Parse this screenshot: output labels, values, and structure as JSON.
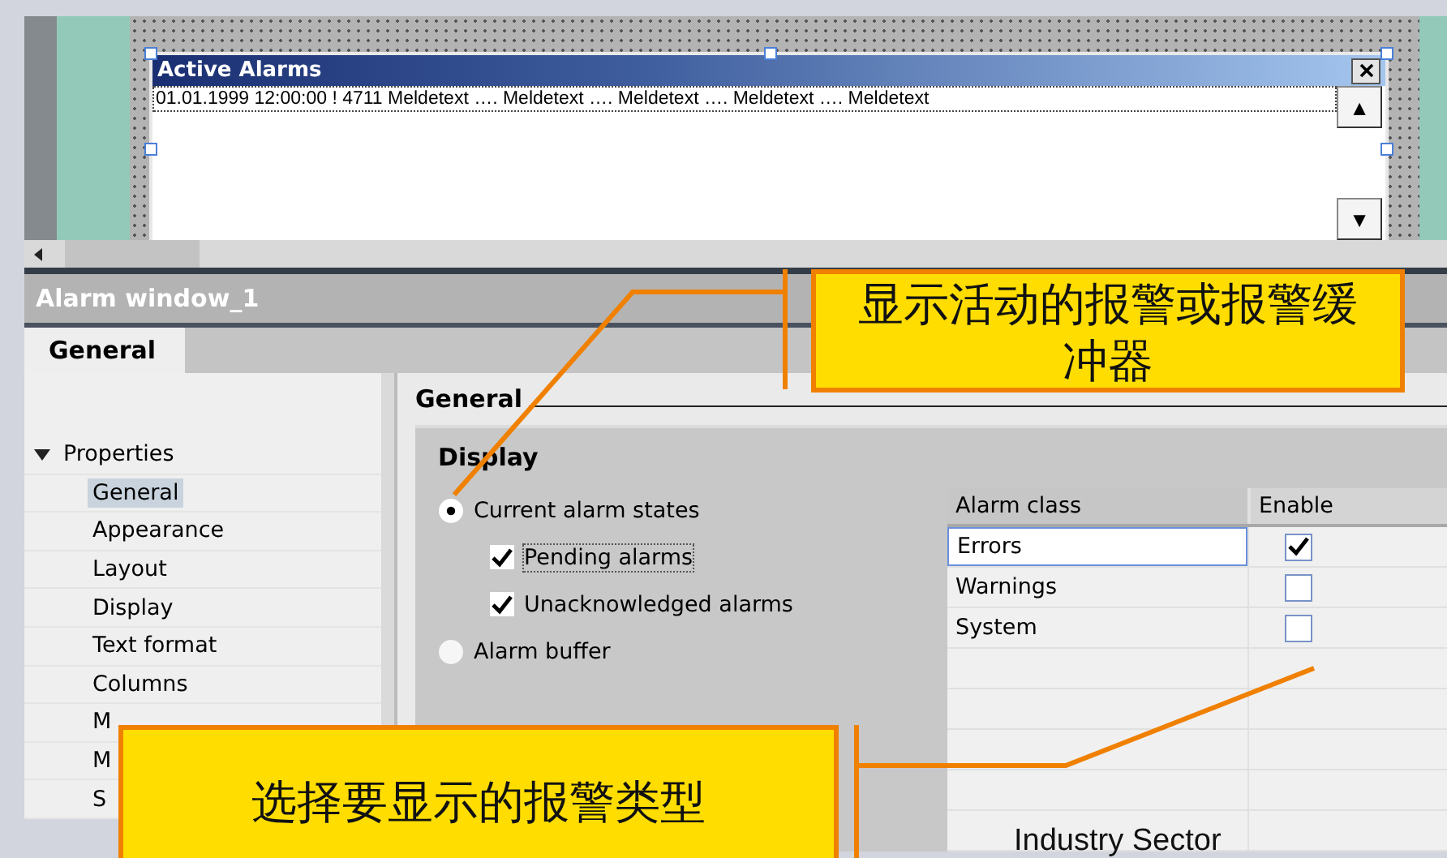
{
  "editor": {
    "alarm_view": {
      "title": "Active Alarms",
      "rows": [
        "01.01.1999 12:00:00 ! 4711 Meldetext …. Meldetext …. Meldetext …. Meldetext …. Meldetext"
      ],
      "up": "▲",
      "down": "▼"
    }
  },
  "inspector": {
    "title": "Alarm window_1",
    "tabs": [
      {
        "label": "General",
        "selected": true
      }
    ],
    "tree": {
      "label": "Properties",
      "expanded": true,
      "children": [
        {
          "label": "General",
          "selected": true
        },
        {
          "label": "Appearance",
          "selected": false
        },
        {
          "label": "Layout",
          "selected": false
        },
        {
          "label": "Display",
          "selected": false
        },
        {
          "label": "Text format",
          "selected": false
        },
        {
          "label": "Columns",
          "selected": false
        },
        {
          "label": "M",
          "selected": false
        },
        {
          "label": "M",
          "selected": false
        },
        {
          "label": "S",
          "selected": false
        }
      ]
    },
    "section_title": "General",
    "group": {
      "title": "Display",
      "options": [
        {
          "kind": "radio",
          "label": "Current alarm states",
          "checked": true
        },
        {
          "kind": "checkbox",
          "label": "Pending alarms",
          "checked": true
        },
        {
          "kind": "checkbox",
          "label": "Unacknowledged alarms",
          "checked": true
        },
        {
          "kind": "radio",
          "label": "Alarm buffer",
          "checked": false
        }
      ]
    },
    "table": {
      "columns": [
        "Alarm class",
        "Enable"
      ],
      "rows": [
        {
          "name": "Errors",
          "enabled": true,
          "selected": true
        },
        {
          "name": "Warnings",
          "enabled": false,
          "selected": false
        },
        {
          "name": "System",
          "enabled": false,
          "selected": false
        }
      ]
    }
  },
  "callouts": [
    {
      "text": "显示活动的报警或报警缓冲器"
    },
    {
      "text": "选择要显示的报警类型"
    }
  ],
  "footer": "Industry Sector"
}
